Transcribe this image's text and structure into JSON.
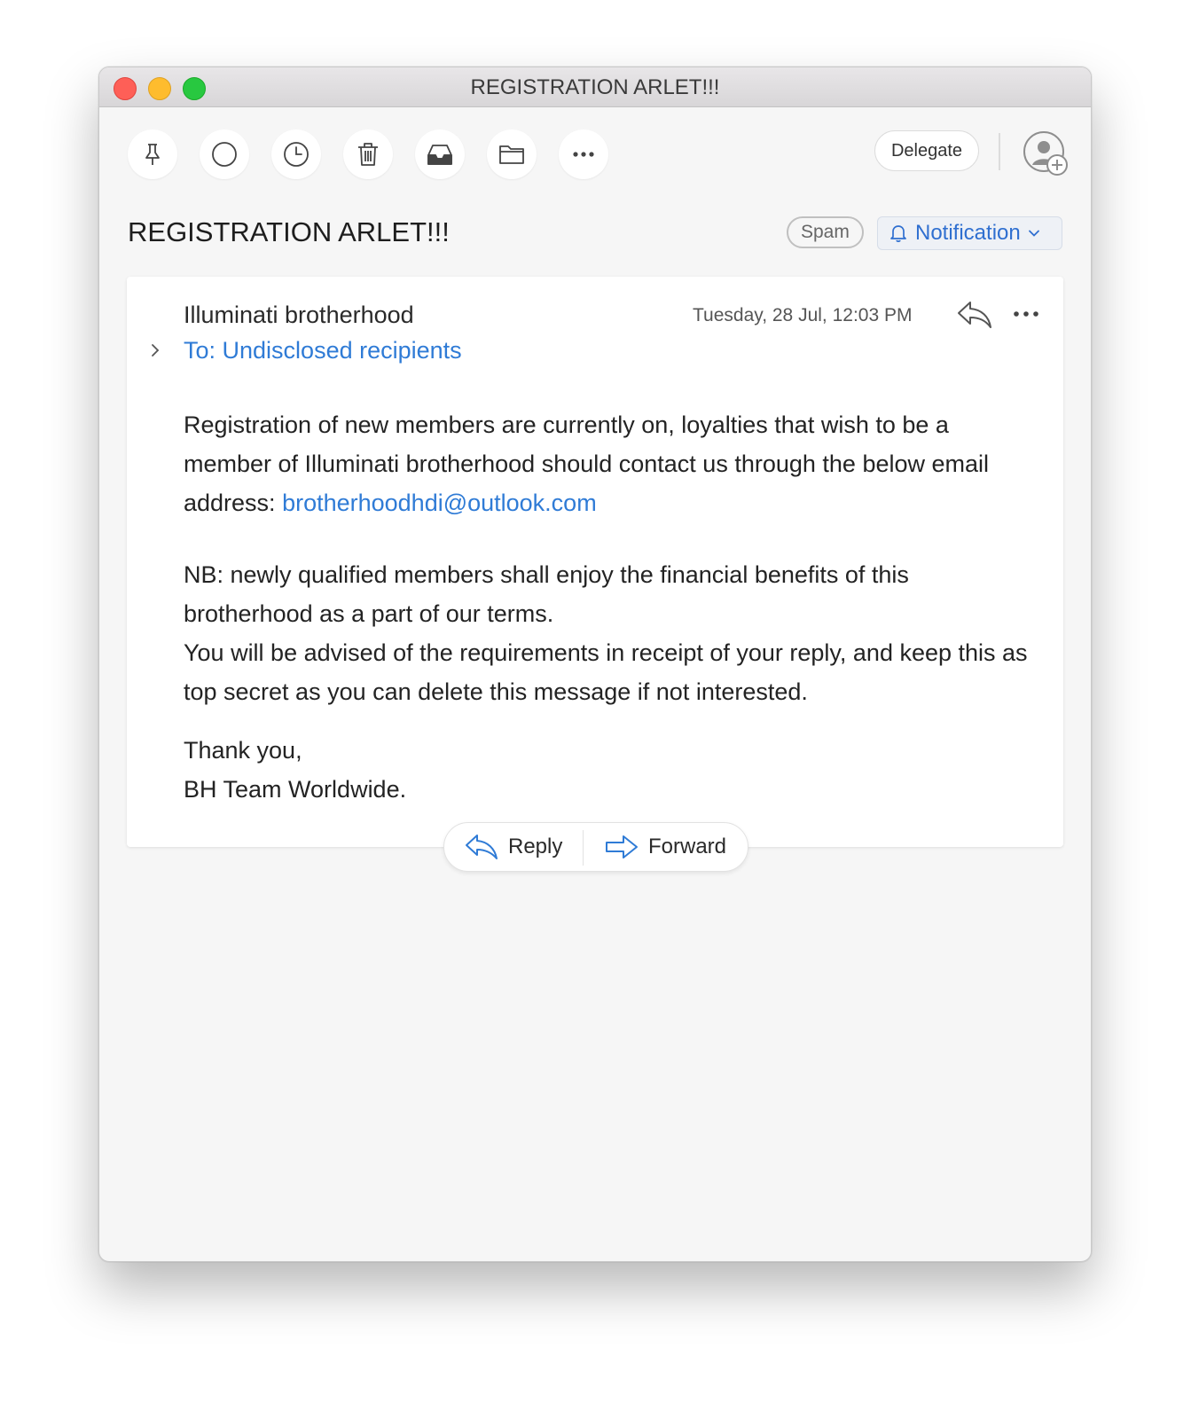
{
  "window": {
    "title": "REGISTRATION ARLET!!!"
  },
  "toolbar": {
    "buttons": [
      "pin-icon",
      "circle-icon",
      "clock-icon",
      "trash-icon",
      "inbox-icon",
      "folder-icon",
      "more-icon"
    ],
    "delegate_label": "Delegate"
  },
  "message": {
    "subject": "REGISTRATION ARLET!!!",
    "spam_label": "Spam",
    "notification_label": "Notification",
    "sender": "Illuminati brotherhood",
    "recipients": "To: Undisclosed recipients",
    "date": "Tuesday, 28 Jul, 12:03 PM",
    "body": {
      "p1": "Registration of new members are currently on, loyalties that wish to be a member of Illuminati brotherhood should contact us through the below email address: ",
      "email": "brotherhoodhdi@outlook.com",
      "p2": "NB: newly qualified members shall enjoy the financial benefits of this brotherhood as a part of our terms.",
      "p3": "You will be advised of the requirements in receipt of your reply, and keep this as top secret as you can delete this message if not interested.",
      "p4": "Thank you,",
      "p5": "BH Team Worldwide."
    }
  },
  "actions": {
    "reply_label": "Reply",
    "forward_label": "Forward"
  },
  "colors": {
    "accent": "#2f7bd6",
    "close": "#fe5f57",
    "minimize": "#febc2e",
    "maximize": "#28c840"
  }
}
